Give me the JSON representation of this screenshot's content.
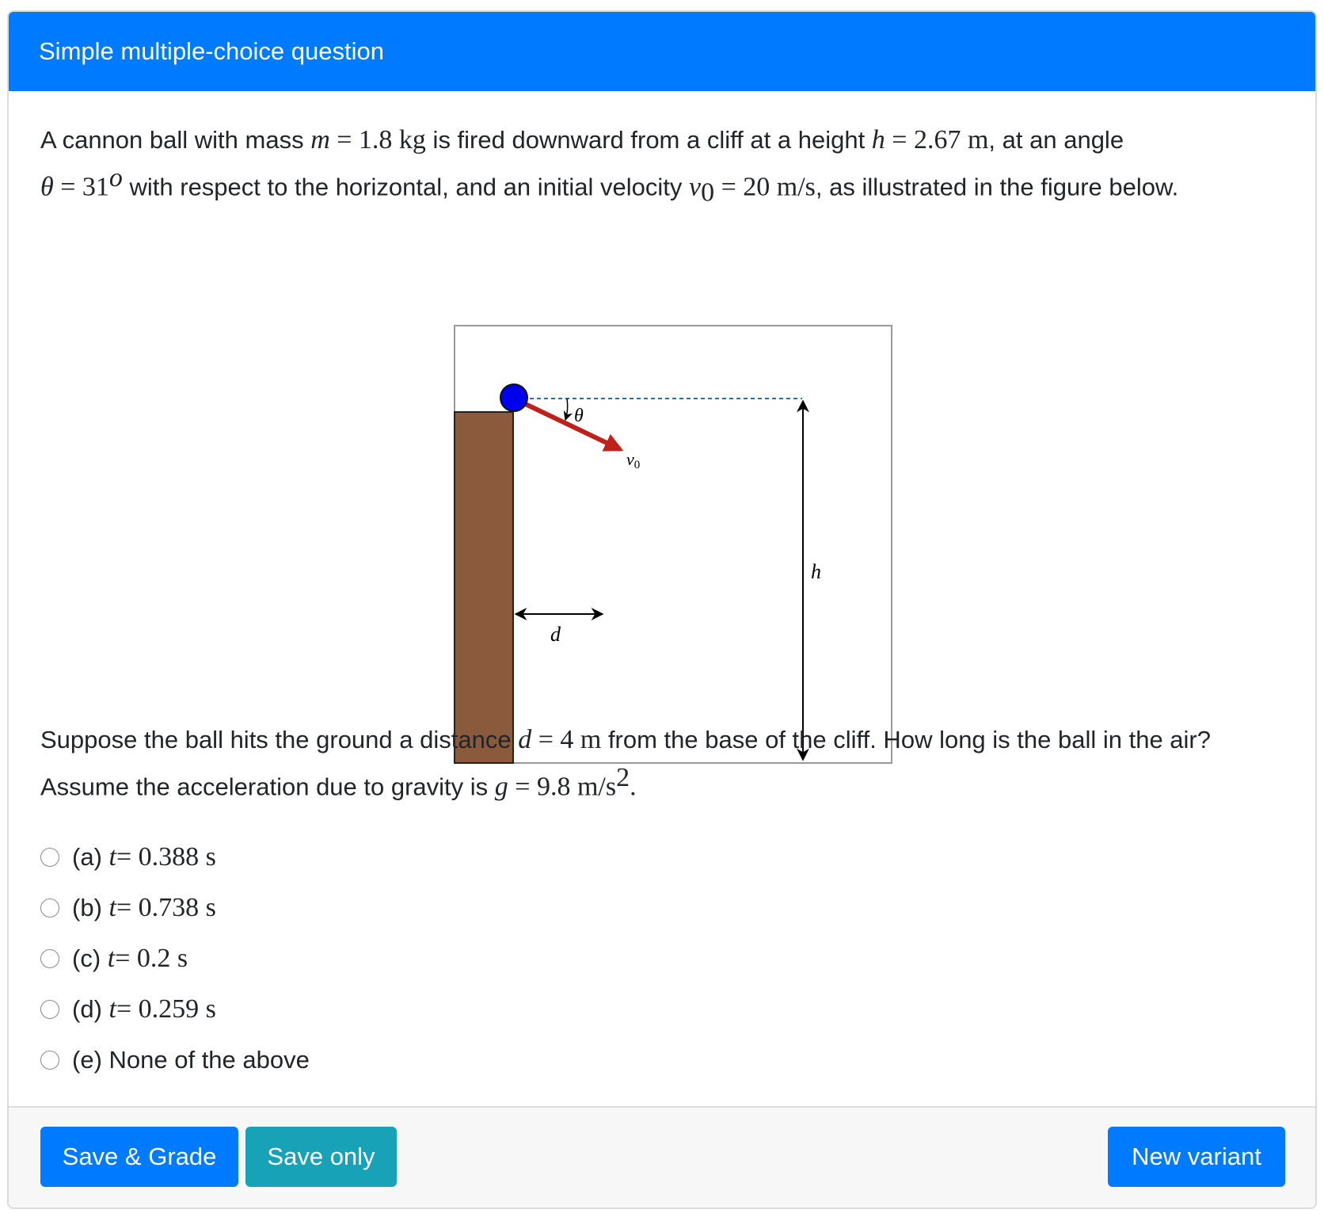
{
  "header": {
    "title": "Simple multiple-choice question"
  },
  "question": {
    "p1_a": "A cannon ball with mass ",
    "p1_m": "m",
    "p1_eq1": " = 1.8 kg",
    "p1_b": " is fired downward from a cliff at a height ",
    "p1_h": "h",
    "p1_eq2": " = 2.67 m",
    "p1_c": ", at an angle ",
    "p1_theta": "θ",
    "p1_eq3": " = 31",
    "p1_deg": "o",
    "p1_d": " with respect to the horizontal, and an initial velocity ",
    "p1_v": "v",
    "p1_vsub": "0",
    "p1_eq4": " = 20 m/s",
    "p1_e": ", as illustrated in the figure below.",
    "p2_a": "Suppose the ball hits the ground a distance ",
    "p2_d": "d",
    "p2_eq1": " = 4 m",
    "p2_b": " from the base of the cliff. How long is the ball in the air? Assume the acceleration due to gravity is ",
    "p2_g": "g",
    "p2_eq2": " = 9.8 m/s",
    "p2_sup": "2",
    "p2_c": "."
  },
  "figure": {
    "label_theta": "θ",
    "label_v0": "v",
    "label_v0_sub": "0",
    "label_h": "h",
    "label_d": "d",
    "colors": {
      "cliff": "#8b5a3c",
      "ball": "#0000ee",
      "arrow": "#c0201a",
      "dash": "#1f6fbf"
    }
  },
  "options": [
    {
      "label": "(a) ",
      "var": "t",
      "value": " = 0.388 s"
    },
    {
      "label": "(b) ",
      "var": "t",
      "value": " = 0.738 s"
    },
    {
      "label": "(c) ",
      "var": "t",
      "value": " = 0.2 s"
    },
    {
      "label": "(d) ",
      "var": "t",
      "value": " = 0.259 s"
    },
    {
      "label": "(e) None of the above",
      "var": "",
      "value": ""
    }
  ],
  "footer": {
    "save_grade": "Save & Grade",
    "save_only": "Save only",
    "new_variant": "New variant"
  }
}
